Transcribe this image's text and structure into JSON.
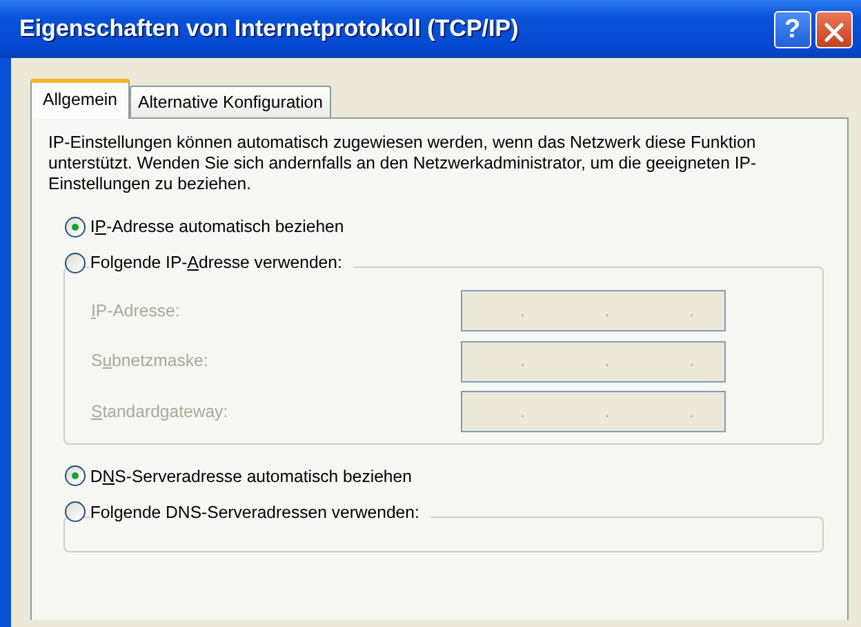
{
  "window": {
    "title": "Eigenschaften von Internetprotokoll (TCP/IP)"
  },
  "title_buttons": [
    {
      "kind": "help",
      "glyph": "?"
    },
    {
      "kind": "close"
    }
  ],
  "tabs": [
    {
      "label": "Allgemein",
      "selected": true
    },
    {
      "label": "Alternative Konfiguration",
      "selected": false
    }
  ],
  "description": "IP-Einstellungen können automatisch zugewiesen werden, wenn das Netzwerk diese Funktion unterstützt. Wenden Sie sich andernfalls an den Netzwerkadministrator, um die geeigneten IP-Einstellungen zu beziehen.",
  "ip_options": [
    {
      "before": "I",
      "key": "P",
      "after": "-Adresse automatisch beziehen",
      "selected": true,
      "kind": "plain"
    },
    {
      "before": "Folgende IP-",
      "key": "A",
      "after": "dresse verwenden:",
      "selected": false,
      "kind": "group"
    }
  ],
  "ip_fields": [
    {
      "key": "I",
      "after": "P-Adresse:",
      "disabled": true,
      "dots": [
        ".",
        ".",
        "."
      ]
    },
    {
      "before": "S",
      "key": "u",
      "after": "bnetzmaske:",
      "disabled": true,
      "dots": [
        ".",
        ".",
        "."
      ]
    },
    {
      "key": "S",
      "after": "tandardgateway:",
      "disabled": true,
      "dots": [
        ".",
        ".",
        "."
      ]
    }
  ],
  "dns_options": [
    {
      "before": "D",
      "key": "N",
      "after": "S-Serveradresse automatisch beziehen",
      "selected": true,
      "kind": "plain"
    },
    {
      "before": "Folgende DNS-Serveradressen verwenden:",
      "selected": false,
      "kind": "group"
    }
  ]
}
